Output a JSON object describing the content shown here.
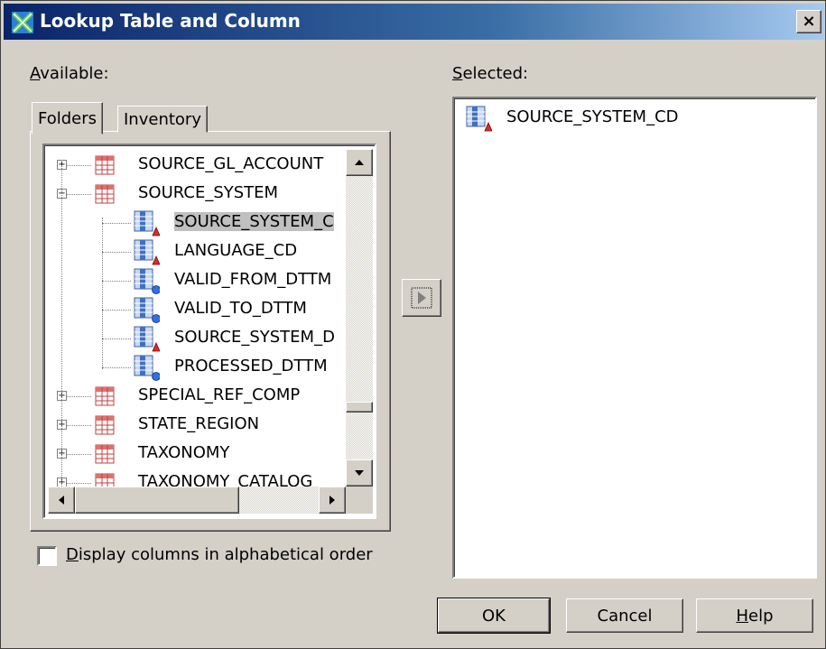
{
  "window": {
    "title": "Lookup Table and Column",
    "close_label": "×"
  },
  "available": {
    "label_accel": "A",
    "label_rest": "vailable:"
  },
  "selected": {
    "label_accel": "S",
    "label_rest": "elected:"
  },
  "tabs": [
    {
      "label": "Folders",
      "active": true
    },
    {
      "label": "Inventory",
      "active": false
    }
  ],
  "tree": [
    {
      "label": "SOURCE_GL_ACCOUNT",
      "kind": "table",
      "expander": "+"
    },
    {
      "label": "SOURCE_SYSTEM",
      "kind": "table",
      "expander": "−"
    },
    {
      "label": "SOURCE_SYSTEM_C",
      "kind": "column-key",
      "selected": true
    },
    {
      "label": "LANGUAGE_CD",
      "kind": "column-key"
    },
    {
      "label": "VALID_FROM_DTTM",
      "kind": "column-info"
    },
    {
      "label": "VALID_TO_DTTM",
      "kind": "column-info"
    },
    {
      "label": "SOURCE_SYSTEM_D",
      "kind": "column-key"
    },
    {
      "label": "PROCESSED_DTTM",
      "kind": "column-info"
    },
    {
      "label": "SPECIAL_REF_COMP",
      "kind": "table",
      "expander": "+"
    },
    {
      "label": "STATE_REGION",
      "kind": "table",
      "expander": "+"
    },
    {
      "label": "TAXONOMY",
      "kind": "table",
      "expander": "+"
    },
    {
      "label": "TAXONOMY_CATALOG",
      "kind": "table",
      "expander": "+"
    }
  ],
  "selected_items": [
    {
      "label": "SOURCE_SYSTEM_CD",
      "kind": "column-key"
    }
  ],
  "checkbox": {
    "accel": "D",
    "rest": "isplay columns in alphabetical order",
    "checked": false
  },
  "buttons": {
    "ok": "OK",
    "cancel": "Cancel",
    "help_accel": "H",
    "help_rest": "elp"
  },
  "icons": {
    "move_right": "move-right-arrow-icon",
    "up": "scroll-up-arrow-icon",
    "down": "scroll-down-arrow-icon",
    "left": "scroll-left-arrow-icon",
    "right": "scroll-right-arrow-icon"
  }
}
